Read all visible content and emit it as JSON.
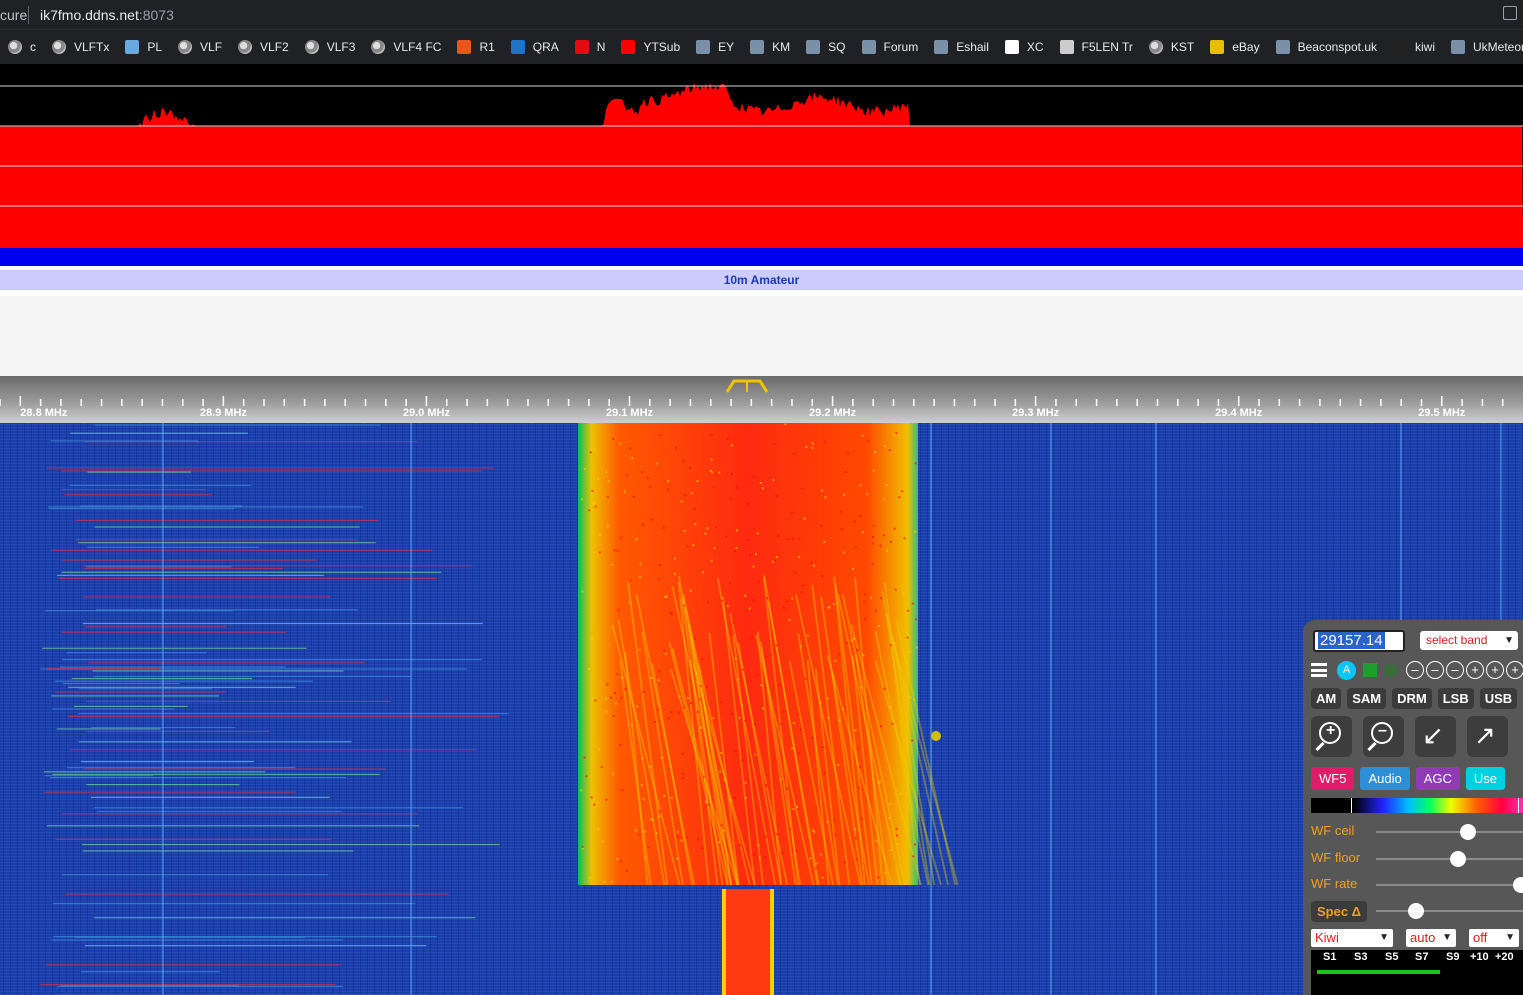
{
  "browser": {
    "security_label": "cure",
    "host": "ik7fmo.ddns.net",
    "port": ":8073"
  },
  "bookmarks": [
    {
      "label": "c",
      "icon": "globe-icon"
    },
    {
      "label": "VLFTx",
      "icon": "globe-icon"
    },
    {
      "label": "PL",
      "icon": "image-icon"
    },
    {
      "label": "VLF",
      "icon": "globe-icon"
    },
    {
      "label": "VLF2",
      "icon": "globe-icon"
    },
    {
      "label": "VLF3",
      "icon": "globe-icon"
    },
    {
      "label": "VLF4 FC",
      "icon": "globe-icon"
    },
    {
      "label": "R1",
      "icon": "office-icon"
    },
    {
      "label": "QRA",
      "icon": "p-icon"
    },
    {
      "label": "N",
      "icon": "netflix-icon"
    },
    {
      "label": "YTSub",
      "icon": "youtube-icon"
    },
    {
      "label": "EY",
      "icon": "site-icon"
    },
    {
      "label": "KM",
      "icon": "site-icon"
    },
    {
      "label": "SQ",
      "icon": "site-icon"
    },
    {
      "label": "Forum",
      "icon": "site-icon"
    },
    {
      "label": "Eshail",
      "icon": "site-icon"
    },
    {
      "label": "XC",
      "icon": "arrow-icon"
    },
    {
      "label": "F5LEN Tr",
      "icon": "wordpress-icon"
    },
    {
      "label": "KST",
      "icon": "globe-icon"
    },
    {
      "label": "eBay",
      "icon": "bag-icon"
    },
    {
      "label": "Beaconspot.uk",
      "icon": "site-icon"
    },
    {
      "label": "kiwi",
      "icon": "kiwi-icon"
    },
    {
      "label": "UkMeteor",
      "icon": "site-icon"
    }
  ],
  "band_bar": {
    "label": "10m Amateur"
  },
  "scale": {
    "labels": [
      "28.8 MHz",
      "28.9 MHz",
      "29.0 MHz",
      "29.1 MHz",
      "29.2 MHz",
      "29.3 MHz",
      "29.4 MHz",
      "29.5 MHz"
    ],
    "start_mhz": 28.79,
    "end_mhz": 29.54
  },
  "control_panel": {
    "frequency": "29157.14",
    "band_select": "select band",
    "modes": [
      "AM",
      "SAM",
      "DRM",
      "LSB",
      "USB"
    ],
    "tabs": [
      {
        "label": "WF5",
        "color": "#e01b6a"
      },
      {
        "label": "Audio",
        "color": "#2d8fd6"
      },
      {
        "label": "AGC",
        "color": "#8f3bb5"
      },
      {
        "label": "Use",
        "color": "#00d0e0"
      }
    ],
    "sliders": [
      {
        "label": "WF ceil",
        "value": 0.6
      },
      {
        "label": "WF floor",
        "value": 0.53
      },
      {
        "label": "WF rate",
        "value": 0.98
      }
    ],
    "spec_label": "Spec Δ",
    "spec_value": 0.23,
    "selects": [
      "Kiwi",
      "auto",
      "off"
    ],
    "smeter": {
      "labels": [
        "S1",
        "S3",
        "S5",
        "S7",
        "S9",
        "+10",
        "+20"
      ],
      "level": 0.6
    }
  }
}
